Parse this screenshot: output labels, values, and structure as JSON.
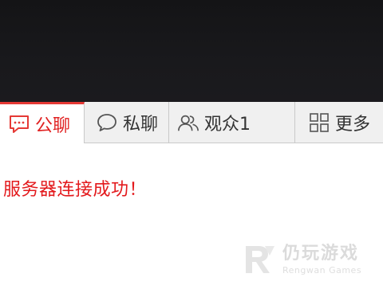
{
  "tabs": [
    {
      "label": "公聊",
      "icon": "chat-bubble-icon",
      "active": true
    },
    {
      "label": "私聊",
      "icon": "speech-bubble-icon",
      "active": false
    },
    {
      "label": "观众1",
      "icon": "users-icon",
      "active": false
    },
    {
      "label": "更多",
      "icon": "grid-icon",
      "active": false
    }
  ],
  "message": {
    "text": "服务器连接成功！",
    "color": "#e3191c"
  },
  "watermark": {
    "title": "仍玩游戏",
    "subtitle": "Rengwan Games"
  },
  "colors": {
    "accent": "#e53935",
    "video_bg": "#19191c"
  }
}
